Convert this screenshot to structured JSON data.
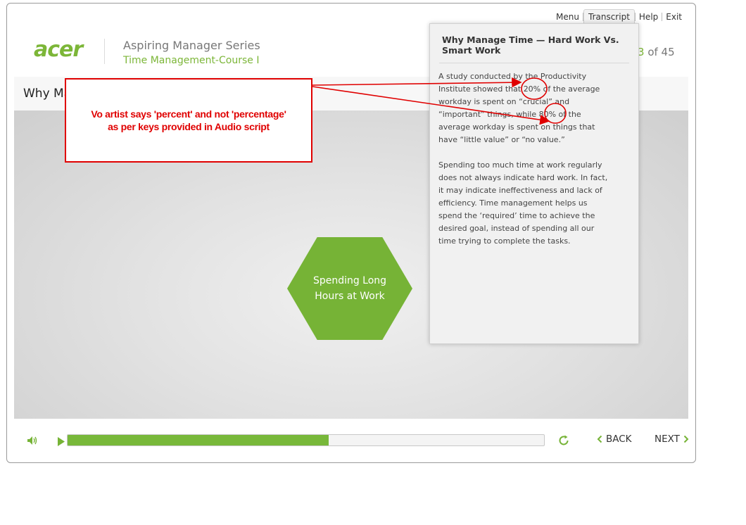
{
  "nav": {
    "menu": "Menu",
    "transcript": "Transcript",
    "help": "Help",
    "exit": "Exit"
  },
  "brand": {
    "logo": "acer",
    "series": "Aspiring Manager Series",
    "course": "Time Management-Course I"
  },
  "page_counter": {
    "current": "3",
    "of_total": " of 45"
  },
  "slide": {
    "title_visible": "Why Ma"
  },
  "hexagon": {
    "line1": "Spending Long",
    "line2": "Hours at Work"
  },
  "transcript_panel": {
    "title": "Why Manage Time — Hard Work Vs. Smart Work",
    "paragraphs": [
      "A study conducted by the Productivity Institute showed that 20% of the average workday is spent on “crucial” and “important” things, while 80% of the average workday is spent on things that have “little value” or “no value.”",
      "Spending too much time at work regularly does not always indicate hard work. In fact, it may indicate ineffectiveness and lack of efficiency. Time management helps us spend the ‘required’ time to achieve the desired goal, instead of spending all our time trying to complete the tasks."
    ]
  },
  "review_comment": {
    "line1": "Vo artist says 'percent' and not 'percentage'",
    "line2": "as per keys provided in Audio script"
  },
  "player": {
    "progress_fraction": 0.548,
    "back_label": "BACK",
    "next_label": "NEXT"
  },
  "colors": {
    "accent_green": "#78b83a",
    "annotation_red": "#e00000"
  },
  "icons": [
    "volume-icon",
    "play-icon",
    "replay-icon",
    "chevron-left-icon",
    "chevron-right-icon"
  ]
}
